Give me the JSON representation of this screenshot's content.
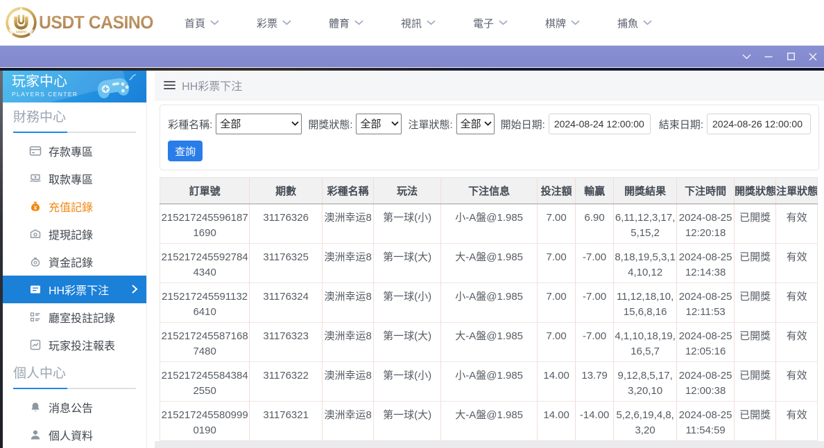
{
  "brand": {
    "name": "USDT CASINO",
    "coin_letter": "U",
    "coin_caption": "casino"
  },
  "topnav": {
    "items": [
      {
        "label": "首頁"
      },
      {
        "label": "彩票"
      },
      {
        "label": "體育"
      },
      {
        "label": "視訊"
      },
      {
        "label": "電子"
      },
      {
        "label": "棋牌"
      },
      {
        "label": "捕魚"
      }
    ]
  },
  "sidebar": {
    "title": "玩家中心",
    "subtitle": "PLAYERS CENTER",
    "sections": [
      {
        "title": "財務中心",
        "items": [
          {
            "label": "存款專區",
            "icon": "deposit"
          },
          {
            "label": "取款專區",
            "icon": "withdraw"
          },
          {
            "label": "充值記錄",
            "icon": "recharge",
            "modifier": "accent-orange"
          },
          {
            "label": "提現記錄",
            "icon": "cashout"
          },
          {
            "label": "資金記錄",
            "icon": "funds"
          },
          {
            "label": "HH彩票下注",
            "icon": "lottery",
            "modifier": "active"
          },
          {
            "label": "廳室投註記錄",
            "icon": "hallbet"
          },
          {
            "label": "玩家投注報表",
            "icon": "report"
          }
        ]
      },
      {
        "title": "個人中心",
        "items": [
          {
            "label": "消息公告",
            "icon": "bell"
          },
          {
            "label": "個人資料",
            "icon": "user"
          }
        ]
      }
    ]
  },
  "page": {
    "breadcrumb": "HH彩票下注"
  },
  "filters": {
    "lottery_name": {
      "label": "彩種名稱:",
      "value": "全部"
    },
    "draw_status": {
      "label": "開獎狀態:",
      "value": "全部"
    },
    "order_status": {
      "label": "注單狀態:",
      "value": "全部"
    },
    "start_date": {
      "label": "開始日期:",
      "value": "2024-08-24 12:00:00"
    },
    "end_date": {
      "label": "結束日期:",
      "value": "2024-08-26 12:00:00"
    },
    "query_label": "查詢"
  },
  "table": {
    "columns": [
      "訂單號",
      "期數",
      "彩種名稱",
      "玩法",
      "下注信息",
      "投注額",
      "輸贏",
      "開獎結果",
      "下注時間",
      "開獎狀態",
      "注單狀態"
    ],
    "rows": [
      [
        "2152172455961871690",
        "31176326",
        "澳洲幸运8",
        "第一球(小)",
        "小-A盤@1.985",
        "7.00",
        "6.90",
        "6,11,12,3,17,5,15,2",
        "2024-08-25 12:20:18",
        "已開獎",
        "有效"
      ],
      [
        "2152172455927844340",
        "31176325",
        "澳洲幸运8",
        "第一球(大)",
        "大-A盤@1.985",
        "7.00",
        "-7.00",
        "8,18,19,5,3,14,10,12",
        "2024-08-25 12:14:38",
        "已開獎",
        "有效"
      ],
      [
        "2152172455911326410",
        "31176324",
        "澳洲幸运8",
        "第一球(小)",
        "小-A盤@1.985",
        "7.00",
        "-7.00",
        "11,12,18,10,15,6,8,16",
        "2024-08-25 12:11:53",
        "已開獎",
        "有效"
      ],
      [
        "2152172455871687480",
        "31176323",
        "澳洲幸运8",
        "第一球(大)",
        "大-A盤@1.985",
        "7.00",
        "-7.00",
        "4,1,10,18,19,16,5,7",
        "2024-08-25 12:05:16",
        "已開獎",
        "有效"
      ],
      [
        "2152172455843842550",
        "31176322",
        "澳洲幸运8",
        "第一球(小)",
        "小-A盤@1.985",
        "14.00",
        "13.79",
        "9,12,8,5,17,3,20,10",
        "2024-08-25 12:00:38",
        "已開獎",
        "有效"
      ],
      [
        "2152172455809990190",
        "31176321",
        "澳洲幸运8",
        "第一球(大)",
        "大-A盤@1.985",
        "14.00",
        "-14.00",
        "5,2,6,19,4,8,3,20",
        "2024-08-25 11:54:59",
        "已開獎",
        "有效"
      ]
    ]
  }
}
